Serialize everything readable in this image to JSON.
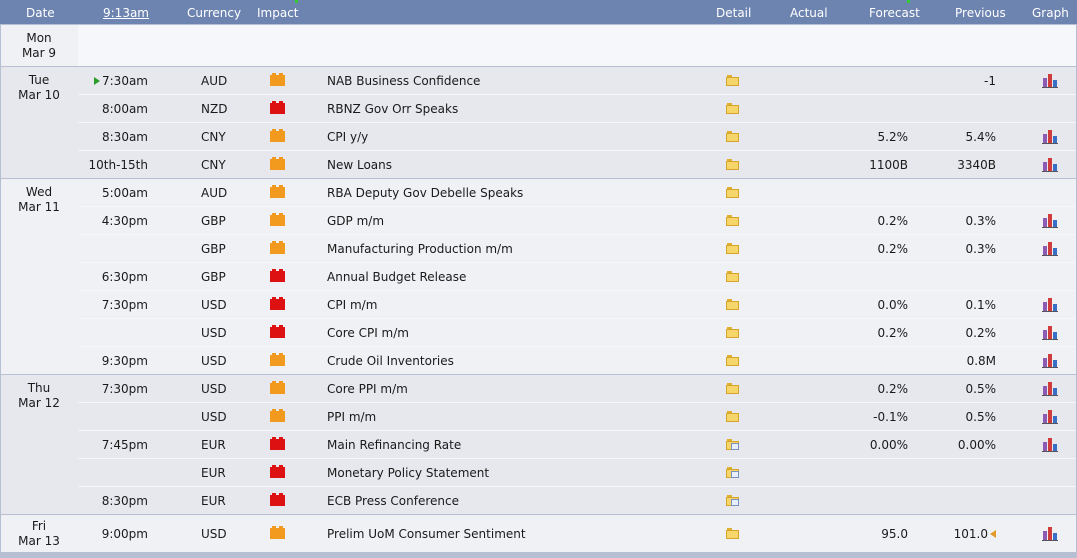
{
  "header": {
    "date": "Date",
    "time": "9:13am",
    "currency": "Currency",
    "impact": "Impact",
    "detail": "Detail",
    "actual": "Actual",
    "forecast": "Forecast",
    "previous": "Previous",
    "graph": "Graph"
  },
  "colors": {
    "header_bg": "#6d84b0",
    "row_bg_a": "#e6e8ee",
    "row_bg_b": "#f0f1f5",
    "impact_medium": "#f29a1e",
    "impact_high": "#dd1111"
  },
  "days": [
    {
      "dow": "Mon",
      "date": "Mar 9",
      "bg": "#f0f1f5",
      "height": 42,
      "rows": []
    },
    {
      "dow": "Tue",
      "date": "Mar 10",
      "bg": "#e6e8ee",
      "rows": [
        {
          "time": "7:30am",
          "next": true,
          "currency": "AUD",
          "impact": "medium",
          "event": "NAB Business Confidence",
          "detail_icon": "folder-icon",
          "forecast": "",
          "previous": "-1",
          "graph": true
        },
        {
          "time": "8:00am",
          "currency": "NZD",
          "impact": "high",
          "event": "RBNZ Gov Orr Speaks",
          "detail_icon": "folder-icon",
          "forecast": "",
          "previous": "",
          "graph": false
        },
        {
          "time": "8:30am",
          "currency": "CNY",
          "impact": "medium",
          "event": "CPI y/y",
          "detail_icon": "folder-icon",
          "forecast": "5.2%",
          "previous": "5.4%",
          "graph": true
        },
        {
          "time": "10th-15th",
          "currency": "CNY",
          "impact": "medium",
          "event": "New Loans",
          "detail_icon": "folder-icon",
          "forecast": "1100B",
          "previous": "3340B",
          "graph": true
        }
      ]
    },
    {
      "dow": "Wed",
      "date": "Mar 11",
      "bg": "#f0f1f5",
      "rows": [
        {
          "time": "5:00am",
          "currency": "AUD",
          "impact": "medium",
          "event": "RBA Deputy Gov Debelle Speaks",
          "detail_icon": "folder-icon",
          "forecast": "",
          "previous": "",
          "graph": false
        },
        {
          "time": "4:30pm",
          "currency": "GBP",
          "impact": "medium",
          "event": "GDP m/m",
          "detail_icon": "folder-icon",
          "forecast": "0.2%",
          "previous": "0.3%",
          "graph": true
        },
        {
          "time": "",
          "currency": "GBP",
          "impact": "medium",
          "event": "Manufacturing Production m/m",
          "detail_icon": "folder-icon",
          "forecast": "0.2%",
          "previous": "0.3%",
          "graph": true
        },
        {
          "time": "6:30pm",
          "currency": "GBP",
          "impact": "high",
          "event": "Annual Budget Release",
          "detail_icon": "folder-icon",
          "forecast": "",
          "previous": "",
          "graph": false
        },
        {
          "time": "7:30pm",
          "currency": "USD",
          "impact": "high",
          "event": "CPI m/m",
          "detail_icon": "folder-icon",
          "forecast": "0.0%",
          "previous": "0.1%",
          "graph": true
        },
        {
          "time": "",
          "currency": "USD",
          "impact": "high",
          "event": "Core CPI m/m",
          "detail_icon": "folder-icon",
          "forecast": "0.2%",
          "previous": "0.2%",
          "graph": true
        },
        {
          "time": "9:30pm",
          "currency": "USD",
          "impact": "medium",
          "event": "Crude Oil Inventories",
          "detail_icon": "folder-icon",
          "forecast": "",
          "previous": "0.8M",
          "graph": true
        }
      ]
    },
    {
      "dow": "Thu",
      "date": "Mar 12",
      "bg": "#e6e8ee",
      "rows": [
        {
          "time": "7:30pm",
          "currency": "USD",
          "impact": "medium",
          "event": "Core PPI m/m",
          "detail_icon": "folder-icon",
          "forecast": "0.2%",
          "previous": "0.5%",
          "graph": true
        },
        {
          "time": "",
          "currency": "USD",
          "impact": "medium",
          "event": "PPI m/m",
          "detail_icon": "folder-icon",
          "forecast": "-0.1%",
          "previous": "0.5%",
          "graph": true
        },
        {
          "time": "7:45pm",
          "currency": "EUR",
          "impact": "high",
          "event": "Main Refinancing Rate",
          "detail_icon": "folder-doc-icon",
          "forecast": "0.00%",
          "previous": "0.00%",
          "graph": true
        },
        {
          "time": "",
          "currency": "EUR",
          "impact": "high",
          "event": "Monetary Policy Statement",
          "detail_icon": "folder-doc-icon",
          "forecast": "",
          "previous": "",
          "graph": false
        },
        {
          "time": "8:30pm",
          "currency": "EUR",
          "impact": "high",
          "event": "ECB Press Conference",
          "detail_icon": "folder-doc-icon",
          "forecast": "",
          "previous": "",
          "graph": false
        }
      ]
    },
    {
      "dow": "Fri",
      "date": "Mar 13",
      "bg": "#f0f1f5",
      "rowheight": 38,
      "rows": [
        {
          "time": "9:00pm",
          "currency": "USD",
          "impact": "medium",
          "event": "Prelim UoM Consumer Sentiment",
          "detail_icon": "folder-icon",
          "forecast": "95.0",
          "previous": "101.0",
          "revised": true,
          "graph": true
        }
      ]
    }
  ]
}
